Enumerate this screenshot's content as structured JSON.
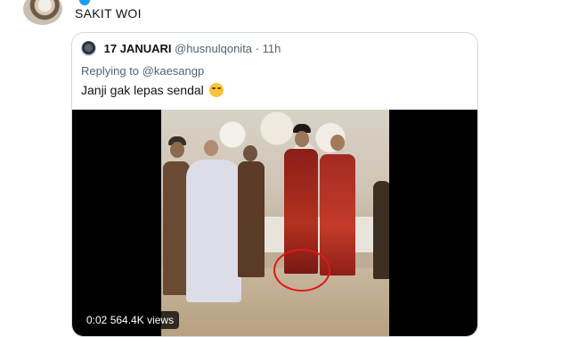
{
  "tweet": {
    "author": "",
    "text": "SAKIT WOI"
  },
  "quote": {
    "name": "17 JANUARI",
    "handle": "@husnulqonita",
    "separator": "·",
    "time": "11h",
    "replying_to": "Replying to @kaesangp",
    "text": "Janji gak lepas sendal"
  },
  "video": {
    "elapsed": "0:02",
    "views": "564.4K views"
  },
  "colors": {
    "verified": "#1d9bf0",
    "circle_annotation": "#e01818"
  }
}
